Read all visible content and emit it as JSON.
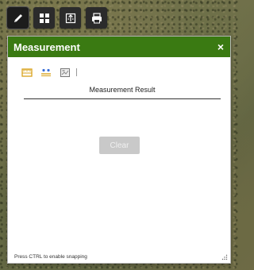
{
  "toolbar": {
    "buttons": [
      {
        "icon": "pencil-icon",
        "active": true
      },
      {
        "icon": "grid-icon",
        "active": false
      },
      {
        "icon": "export-icon",
        "active": false
      },
      {
        "icon": "printer-icon",
        "active": false
      }
    ]
  },
  "panel": {
    "title": "Measurement",
    "close_glyph": "×",
    "tools": [
      {
        "icon": "distance-measure-icon",
        "color": "#d8a21a"
      },
      {
        "icon": "area-measure-icon",
        "color": "#d8a21a"
      },
      {
        "icon": "location-measure-icon",
        "color": "#777777"
      }
    ],
    "separator_glyph": "|",
    "result_label": "Measurement Result",
    "clear_label": "Clear",
    "hint": "Press CTRL to enable snapping"
  },
  "colors": {
    "header_green": "#3a7a12",
    "toolbar_dark": "#2b2b2b",
    "tool_accent": "#d8a21a"
  }
}
